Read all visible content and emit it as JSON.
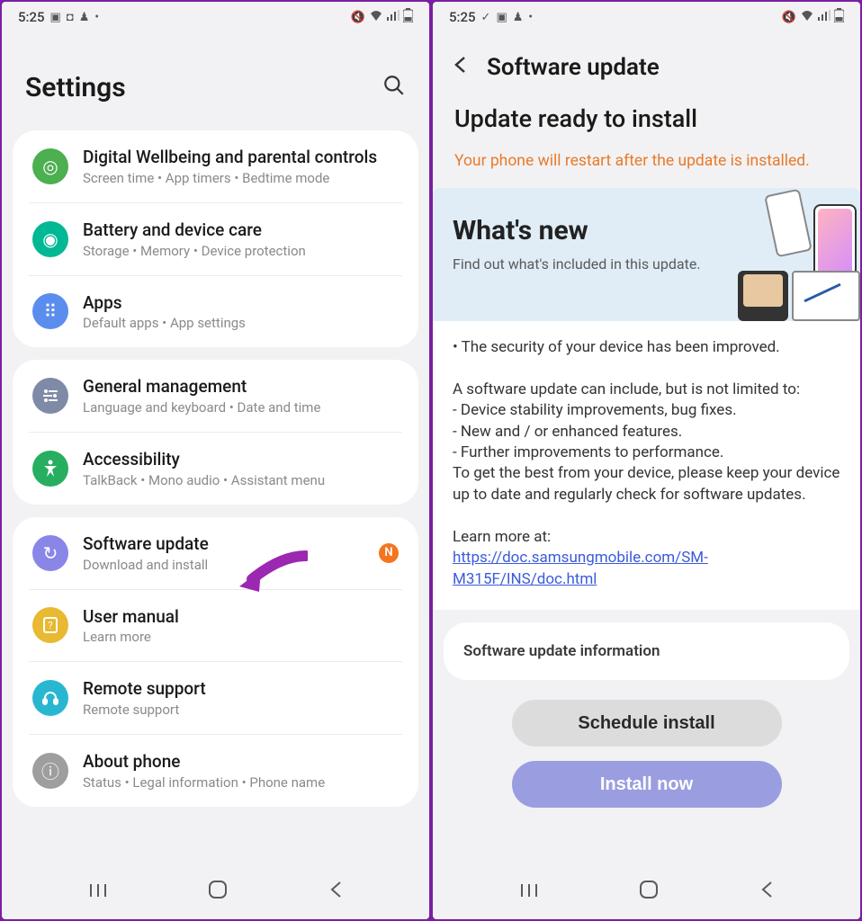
{
  "status": {
    "time": "5:25",
    "icons_left": [
      "image",
      "stop",
      "octopus",
      "dot"
    ],
    "icons_right": [
      "mute",
      "wifi",
      "signal",
      "battery"
    ]
  },
  "screen1": {
    "title": "Settings",
    "groups": [
      {
        "items": [
          {
            "icon_bg": "#4caf50",
            "glyph": "◎",
            "title": "Digital Wellbeing and parental controls",
            "sub": "Screen time  •  App timers  •  Bedtime mode"
          },
          {
            "icon_bg": "#00b894",
            "glyph": "◉",
            "title": "Battery and device care",
            "sub": "Storage  •  Memory  •  Device protection"
          },
          {
            "icon_bg": "#5b8def",
            "glyph": "⠿",
            "title": "Apps",
            "sub": "Default apps  •  App settings"
          }
        ]
      },
      {
        "items": [
          {
            "icon_bg": "#7e8aa6",
            "glyph": "≡",
            "title": "General management",
            "sub": "Language and keyboard  •  Date and time"
          },
          {
            "icon_bg": "#27ae60",
            "glyph": "✚",
            "title": "Accessibility",
            "sub": "TalkBack  •  Mono audio  •  Assistant menu"
          }
        ]
      },
      {
        "items": [
          {
            "icon_bg": "#8a86e8",
            "glyph": "↻",
            "title": "Software update",
            "sub": "Download and install",
            "badge": "N"
          },
          {
            "icon_bg": "#e8b931",
            "glyph": "❘?",
            "title": "User manual",
            "sub": "Learn more"
          },
          {
            "icon_bg": "#29b6d1",
            "glyph": "🎧",
            "title": "Remote support",
            "sub": "Remote support"
          },
          {
            "icon_bg": "#9e9e9e",
            "glyph": "ⓘ",
            "title": "About phone",
            "sub": "Status  •  Legal information  •  Phone name"
          }
        ]
      }
    ]
  },
  "screen2": {
    "header": "Software update",
    "ready": "Update ready to install",
    "warn": "Your phone will restart after the update is installed.",
    "whatsnew": {
      "title": "What's new",
      "sub": "Find out what's included in this update."
    },
    "notes": {
      "bullet": "• The security of your device has been improved.",
      "intro": "A software update can include, but is not limited to:",
      "li1": " - Device stability improvements, bug fixes.",
      "li2": " - New and / or enhanced features.",
      "li3": " - Further improvements to performance.",
      "tail": "To get the best from your device, please keep your device up to date and regularly check for software updates.",
      "learn": "Learn more at:",
      "link": "https://doc.samsungmobile.com/SM-M315F/INS/doc.html"
    },
    "info": "Software update information",
    "btn_schedule": "Schedule install",
    "btn_install": "Install now"
  },
  "nav": {
    "recent": "|||",
    "home": "▢",
    "back": "⟨"
  }
}
